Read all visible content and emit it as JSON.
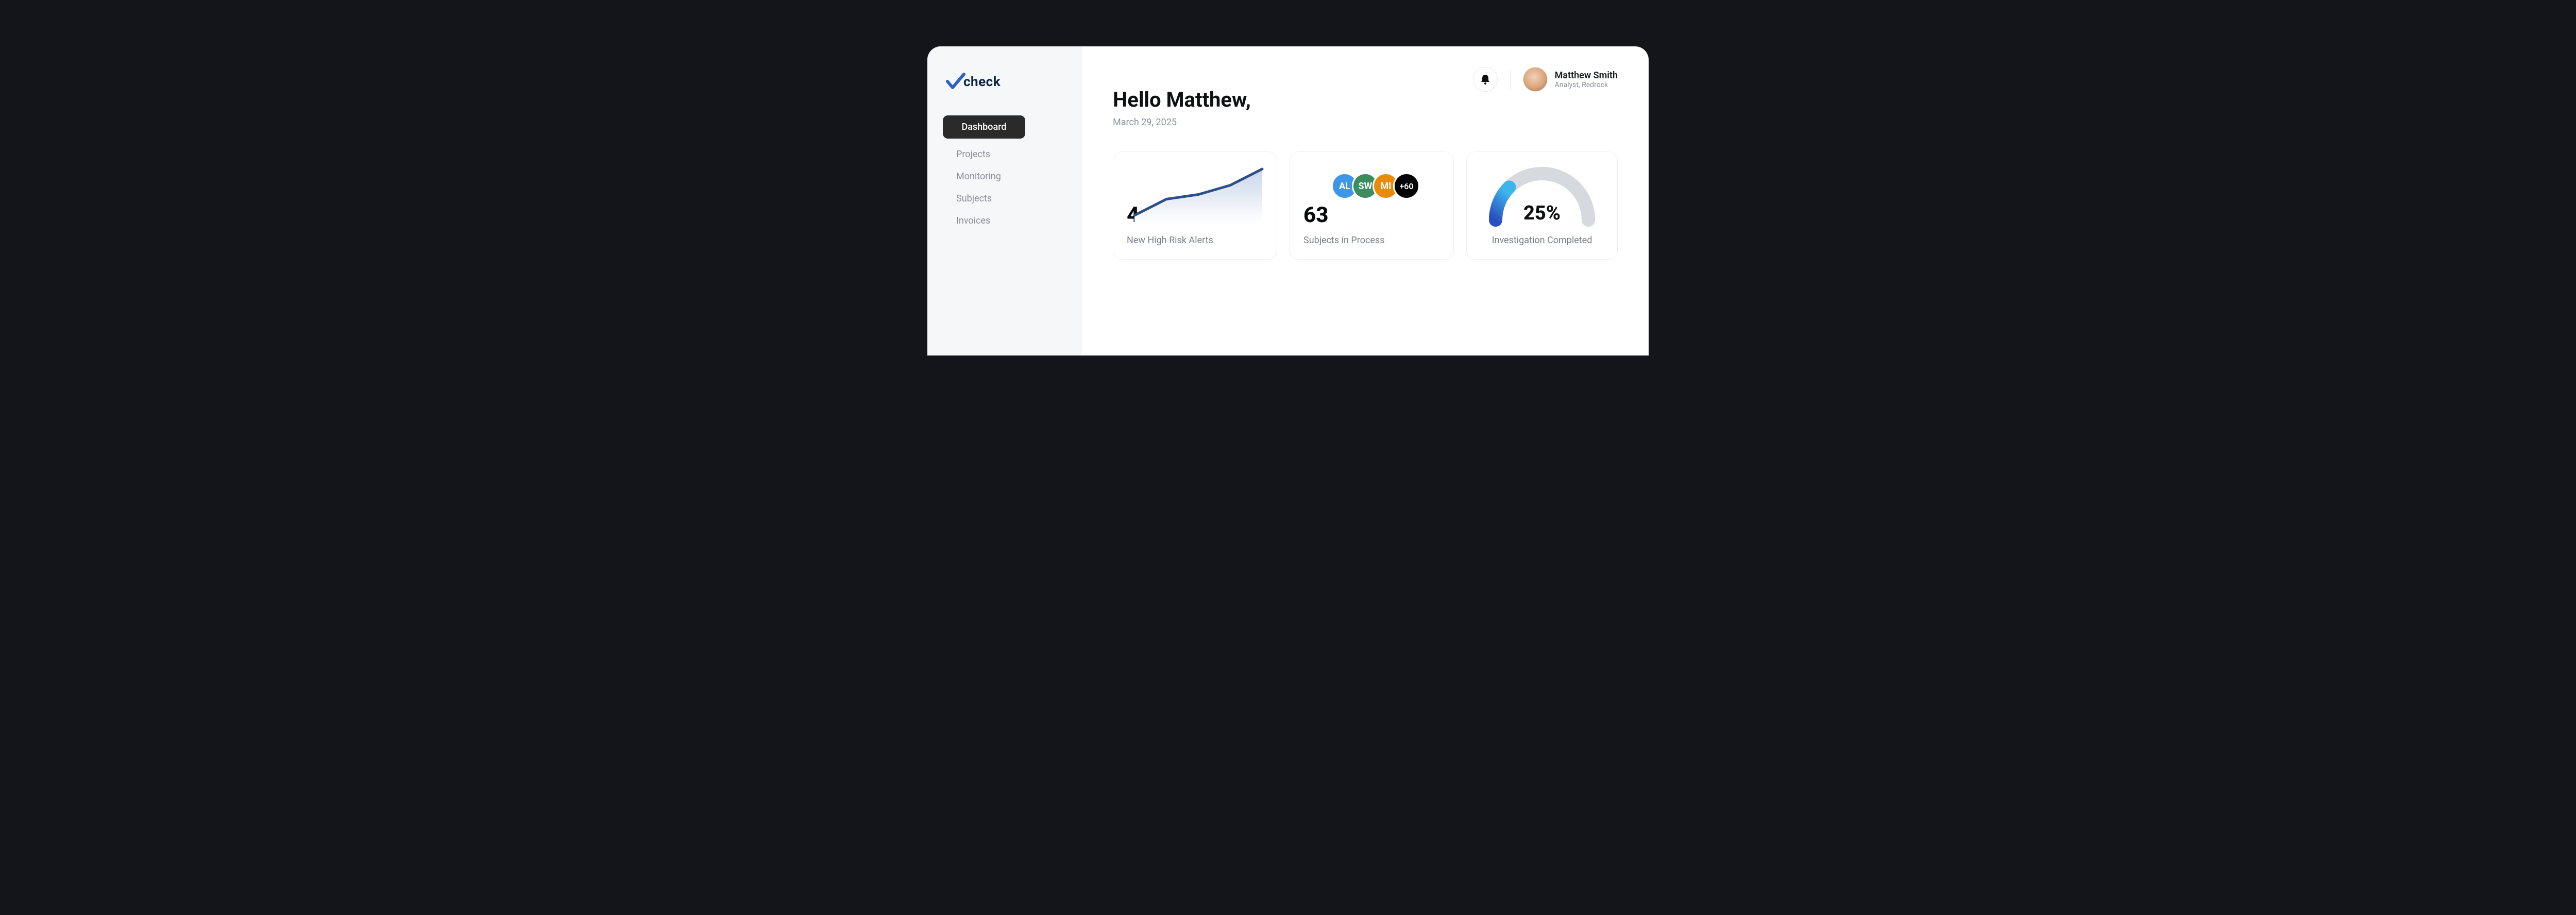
{
  "brand": {
    "name": "check"
  },
  "sidebar": {
    "items": [
      {
        "label": "Dashboard",
        "active": true
      },
      {
        "label": "Projects",
        "active": false
      },
      {
        "label": "Monitoring",
        "active": false
      },
      {
        "label": "Subjects",
        "active": false
      },
      {
        "label": "Invoices",
        "active": false
      }
    ]
  },
  "header": {
    "greeting": "Hello Matthew,",
    "date": "March 29, 2025"
  },
  "user": {
    "name": "Matthew Smith",
    "role": "Analyst, Redrock"
  },
  "cards": {
    "alerts": {
      "value": "4",
      "label": "New High Risk Alerts"
    },
    "subjects": {
      "value": "63",
      "label": "Subjects in Process",
      "chips": [
        "AL",
        "SW",
        "MI"
      ],
      "more": "+60"
    },
    "progress": {
      "pct": "25%",
      "label": "Investigation Completed",
      "fraction": 0.25
    }
  },
  "chart_data": {
    "type": "line",
    "title": "New High Risk Alerts",
    "x": [
      0,
      1,
      2,
      3,
      4
    ],
    "values": [
      10,
      45,
      55,
      75,
      110
    ],
    "ylim": [
      0,
      120
    ],
    "xlabel": "",
    "ylabel": ""
  }
}
